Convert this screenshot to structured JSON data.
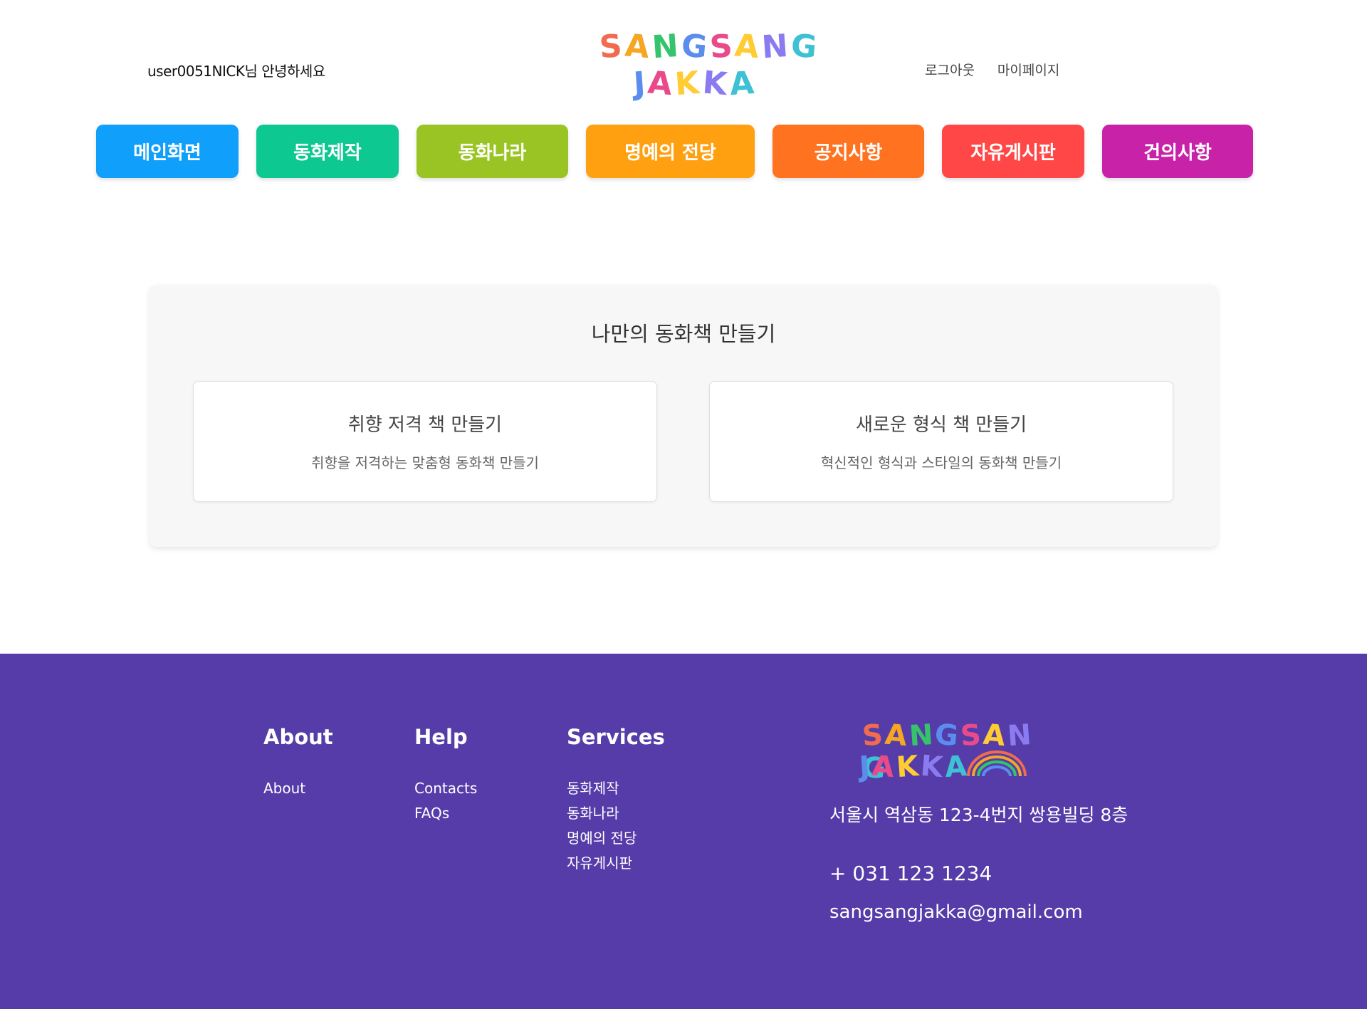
{
  "header": {
    "greeting": "user0051NICK님 안녕하세요",
    "logo_row1": [
      "S",
      "A",
      "N",
      "G",
      "S",
      "A",
      "N",
      "G"
    ],
    "logo_row2": [
      "J",
      "A",
      "K",
      "K",
      "A"
    ],
    "logout": "로그아웃",
    "mypage": "마이페이지"
  },
  "nav": [
    {
      "label": "메인화면",
      "color": "#109ffb"
    },
    {
      "label": "동화제작",
      "color": "#0dc890"
    },
    {
      "label": "동화나라",
      "color": "#9ac423"
    },
    {
      "label": "명예의 전당",
      "color": "#ffa011"
    },
    {
      "label": "공지사항",
      "color": "#ff7220"
    },
    {
      "label": "자유게시판",
      "color": "#ff4747"
    },
    {
      "label": "건의사항",
      "color": "#c822a9"
    }
  ],
  "main": {
    "title": "나만의 동화책 만들기",
    "cards": [
      {
        "title": "취향 저격 책 만들기",
        "desc": "취향을 저격하는 맞춤형 동화책 만들기"
      },
      {
        "title": "새로운 형식 책 만들기",
        "desc": "혁신적인 형식과 스타일의 동화책 만들기"
      }
    ]
  },
  "footer": {
    "about": {
      "heading": "About",
      "items": [
        "About"
      ]
    },
    "help": {
      "heading": "Help",
      "items": [
        "Contacts",
        "FAQs"
      ]
    },
    "services": {
      "heading": "Services",
      "items": [
        "동화제작",
        "동화나라",
        "명예의 전당",
        "자유게시판"
      ]
    },
    "address": "서울시 역삼동 123-4번지 쌍용빌딩 8층",
    "phone": "+ 031 123 1234",
    "email": "sangsangjakka@gmail.com",
    "background": "#553ca9"
  },
  "logo_colors": [
    "#f06b4f",
    "#f5a623",
    "#35c36b",
    "#5b8def",
    "#e94b8a",
    "#ffcc33",
    "#8a7cf0",
    "#3ec1d3"
  ]
}
